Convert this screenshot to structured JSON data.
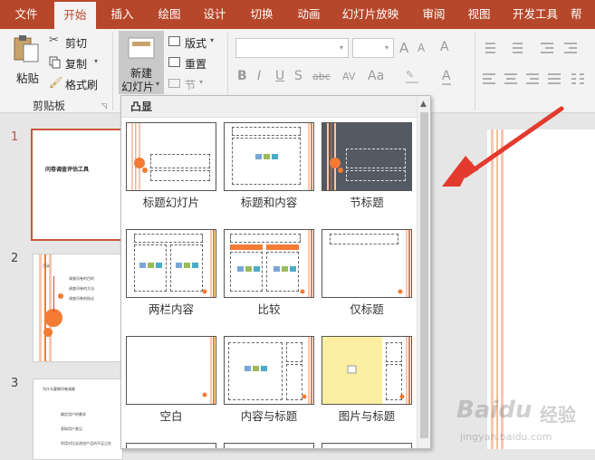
{
  "menu": {
    "tabs": [
      {
        "label": "文件",
        "active": false
      },
      {
        "label": "开始",
        "active": true
      },
      {
        "label": "插入",
        "active": false
      },
      {
        "label": "绘图",
        "active": false
      },
      {
        "label": "设计",
        "active": false
      },
      {
        "label": "切换",
        "active": false
      },
      {
        "label": "动画",
        "active": false
      },
      {
        "label": "幻灯片放映",
        "active": false
      },
      {
        "label": "审阅",
        "active": false
      },
      {
        "label": "视图",
        "active": false
      },
      {
        "label": "开发工具",
        "active": false
      },
      {
        "label": "帮",
        "active": false
      }
    ]
  },
  "ribbon": {
    "clipboard": {
      "paste": "粘贴",
      "cut": "剪切",
      "copy": "复制",
      "format_painter": "格式刷",
      "group_label": "剪贴板"
    },
    "slides": {
      "new_slide_line1": "新建",
      "new_slide_line2": "幻灯片",
      "layout": "版式",
      "reset": "重置",
      "section": "节"
    },
    "font": {
      "grow": "A",
      "shrink": "A",
      "clear": "A",
      "bold": "B",
      "italic": "I",
      "underline": "U",
      "shadow": "S",
      "strike": "abc",
      "spacing": "AV",
      "case": "Aa",
      "color": "A"
    }
  },
  "slides": [
    {
      "number": "1",
      "title": "问卷调查评估工具",
      "selected": true
    },
    {
      "number": "2",
      "title": "目录",
      "items": [
        "调查问卷的目的",
        "调查问卷的方法",
        "调查问卷的结论"
      ],
      "selected": false
    },
    {
      "number": "3",
      "title": "为什么要做问卷调查",
      "items": [
        "确定用户的需求",
        "获取用户意见",
        "利用对比去改进产品的不足之处"
      ],
      "selected": false
    }
  ],
  "dropdown": {
    "header": "凸显",
    "layouts": [
      {
        "name": "标题幻灯片",
        "icon": "title-slide-layout"
      },
      {
        "name": "标题和内容",
        "icon": "title-content-layout"
      },
      {
        "name": "节标题",
        "icon": "section-header-layout"
      },
      {
        "name": "两栏内容",
        "icon": "two-content-layout"
      },
      {
        "name": "比较",
        "icon": "comparison-layout"
      },
      {
        "name": "仅标题",
        "icon": "title-only-layout"
      },
      {
        "name": "空白",
        "icon": "blank-layout"
      },
      {
        "name": "内容与标题",
        "icon": "content-caption-layout"
      },
      {
        "name": "图片与标题",
        "icon": "picture-caption-layout"
      }
    ]
  },
  "watermark": {
    "brand": "Baidu",
    "cn": "经验",
    "url": "jingyan.baidu.com"
  },
  "colors": {
    "accent": "#b7472a",
    "orange": "#f47b33",
    "peach": "#f6c6b0",
    "dark_slate": "#545a64",
    "yellow": "#fcefa1"
  }
}
